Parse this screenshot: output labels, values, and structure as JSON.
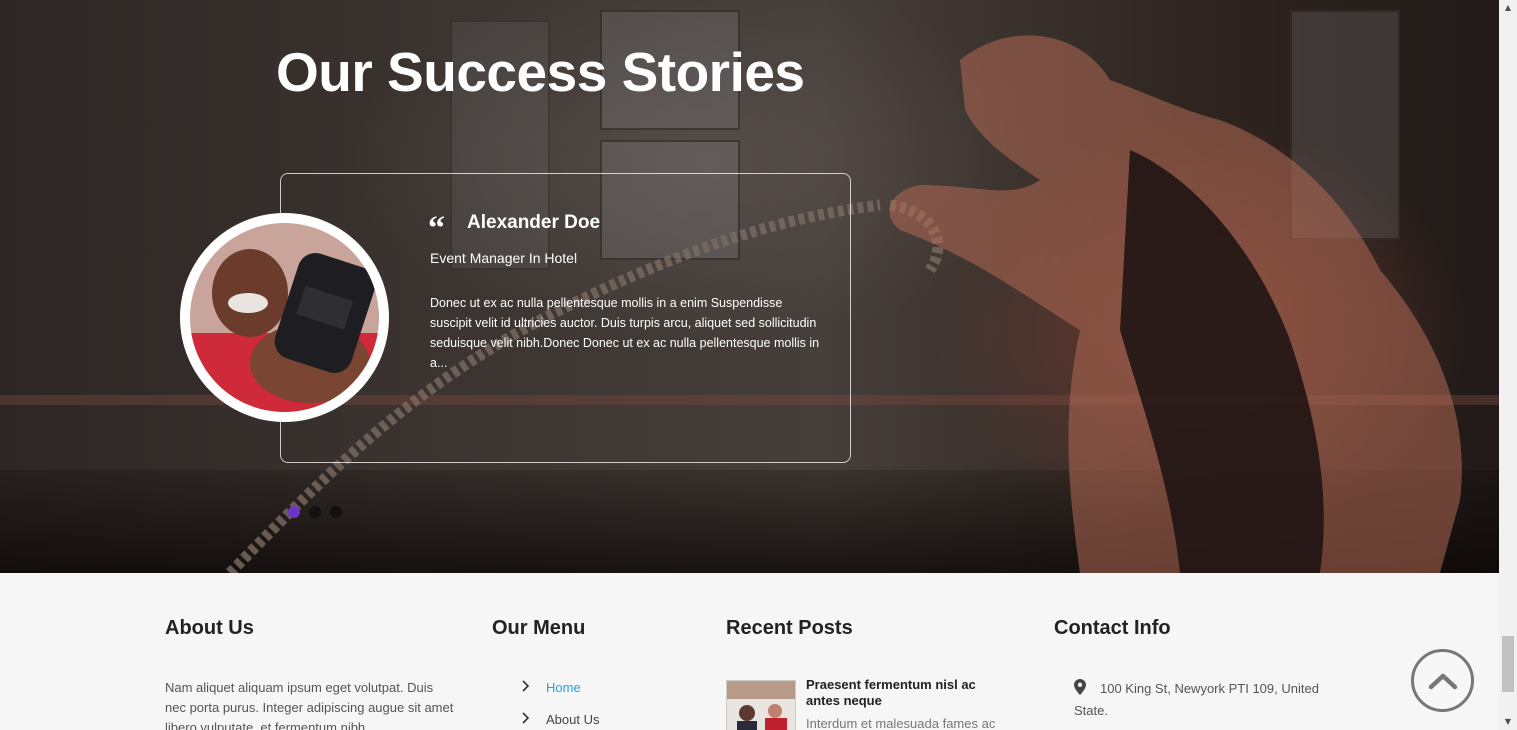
{
  "hero": {
    "title": "Our Success Stories",
    "testimonial": {
      "name": "Alexander Doe",
      "role": "Event Manager In Hotel",
      "text": "Donec ut ex ac nulla pellentesque mollis in a enim Suspendisse suscipit velit id ultricies auctor. Duis turpis arcu, aliquet sed sollicitudin seduisque velit nibh.Donec Donec ut ex ac nulla pellentesque mollis in a...",
      "quote_glyph": "“"
    },
    "carousel": {
      "active_index": 0,
      "count": 3,
      "active_color": "#6a35c7"
    }
  },
  "footer": {
    "about": {
      "heading": "About Us",
      "text": "Nam aliquet aliquam ipsum eget volutpat. Duis nec porta purus. Integer adipiscing augue sit amet libero vulputate, et fermentum nibh"
    },
    "menu": {
      "heading": "Our Menu",
      "items": [
        {
          "label": "Home",
          "active": true
        },
        {
          "label": "About Us",
          "active": false
        }
      ]
    },
    "recent_posts": {
      "heading": "Recent Posts",
      "post": {
        "title": "Praesent fermentum nisl ac antes neque",
        "excerpt": "Interdum et malesuada fames ac"
      }
    },
    "contact": {
      "heading": "Contact Info",
      "address": "100 King St, Newyork PTI 109, United State."
    }
  },
  "colors": {
    "link_active": "#2a9fd8",
    "footer_bg": "#f6f6f6"
  },
  "icons": {
    "quote": "quote-icon",
    "menu_chevron": "chevron-right-icon",
    "contact_pin": "map-marker-icon",
    "back_to_top": "chevron-up-icon"
  }
}
